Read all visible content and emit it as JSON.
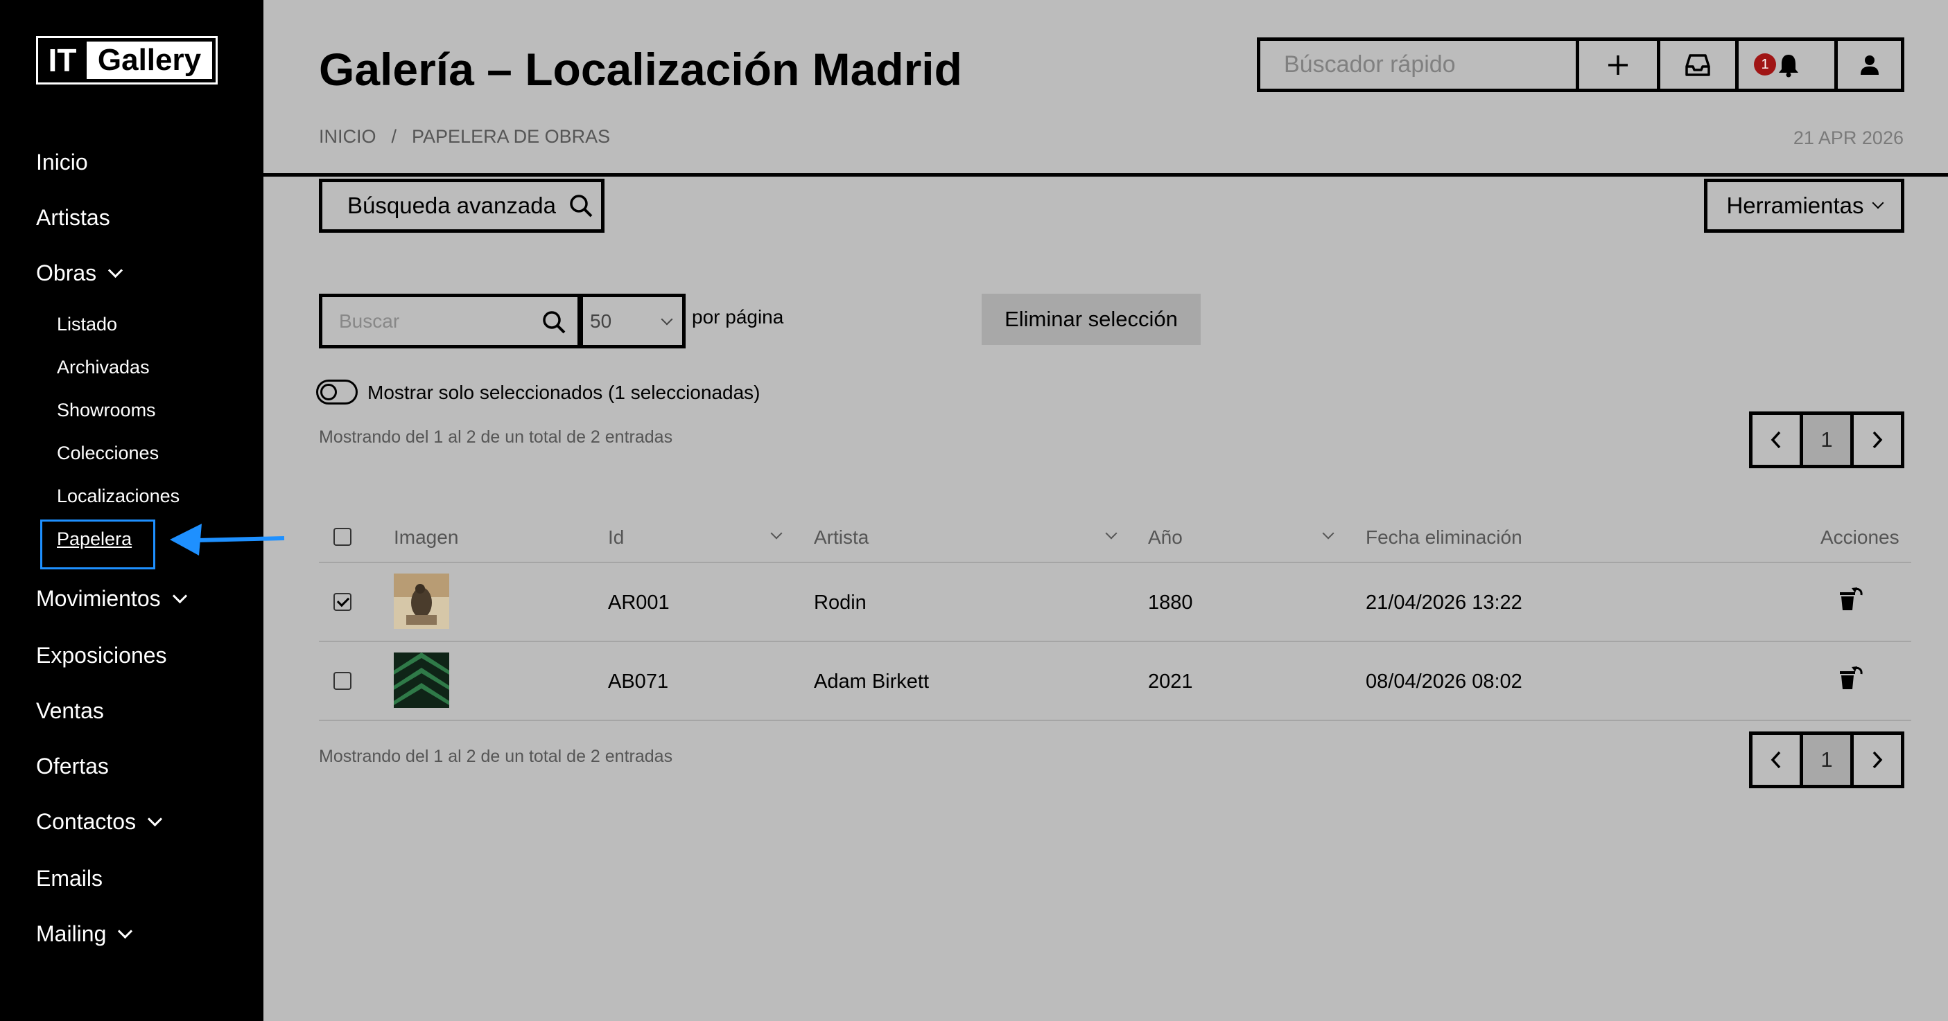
{
  "brand": {
    "logo_left": "IT",
    "logo_right": "Gallery"
  },
  "sidebar": {
    "items": [
      {
        "label": "Inicio"
      },
      {
        "label": "Artistas"
      },
      {
        "label": "Obras"
      },
      {
        "label": "Movimientos"
      },
      {
        "label": "Exposiciones"
      },
      {
        "label": "Ventas"
      },
      {
        "label": "Ofertas"
      },
      {
        "label": "Contactos"
      },
      {
        "label": "Emails"
      },
      {
        "label": "Mailing"
      }
    ],
    "obras_sub": [
      {
        "label": "Listado"
      },
      {
        "label": "Archivadas"
      },
      {
        "label": "Showrooms"
      },
      {
        "label": "Colecciones"
      },
      {
        "label": "Localizaciones"
      },
      {
        "label": "Papelera"
      }
    ]
  },
  "header": {
    "title": "Galería – Localización Madrid",
    "breadcrumb": [
      "INICIO",
      "/",
      "PAPELERA DE OBRAS"
    ],
    "date": "21 APR 2026",
    "quick_search_placeholder": "Búscador rápido",
    "notification_count": "1"
  },
  "toolbar": {
    "advanced_search": "Búsqueda avanzada",
    "tools": "Herramientas"
  },
  "filters": {
    "search_placeholder": "Buscar",
    "per_page_value": "50",
    "per_page_label": "por página",
    "delete_selection": "Eliminar selección",
    "show_selected": "Mostrar solo seleccionados (1 seleccionadas)",
    "showing_text": "Mostrando del 1 al 2 de un total de 2 entradas",
    "current_page": "1"
  },
  "table": {
    "columns": [
      "Imagen",
      "Id",
      "Artista",
      "Año",
      "Fecha eliminación",
      "Acciones"
    ],
    "rows": [
      {
        "checked": true,
        "id": "AR001",
        "artist": "Rodin",
        "year": "1880",
        "deleted": "21/04/2026 13:22"
      },
      {
        "checked": false,
        "id": "AB071",
        "artist": "Adam Birkett",
        "year": "2021",
        "deleted": "08/04/2026 08:02"
      }
    ]
  },
  "colors": {
    "highlight": "#1e90ff",
    "badge": "#a01515",
    "background": "#bcbcbc"
  }
}
